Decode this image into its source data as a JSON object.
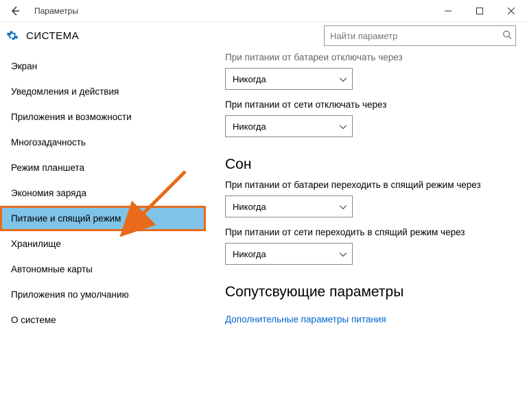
{
  "window": {
    "title": "Параметры"
  },
  "header": {
    "heading": "СИСТЕМА",
    "search_placeholder": "Найти параметр"
  },
  "sidebar": {
    "items": [
      {
        "label": "Экран",
        "selected": false
      },
      {
        "label": "Уведомления и действия",
        "selected": false
      },
      {
        "label": "Приложения и возможности",
        "selected": false
      },
      {
        "label": "Многозадачность",
        "selected": false
      },
      {
        "label": "Режим планшета",
        "selected": false
      },
      {
        "label": "Экономия заряда",
        "selected": false
      },
      {
        "label": "Питание и спящий режим",
        "selected": true
      },
      {
        "label": "Хранилище",
        "selected": false
      },
      {
        "label": "Автономные карты",
        "selected": false
      },
      {
        "label": "Приложения по умолчанию",
        "selected": false
      },
      {
        "label": "О системе",
        "selected": false
      }
    ]
  },
  "content": {
    "screen_off": {
      "battery_label": "При питании от батареи отключать через",
      "battery_value": "Никогда",
      "ac_label": "При питании от сети отключать через",
      "ac_value": "Никогда"
    },
    "sleep": {
      "heading": "Сон",
      "battery_label": "При питании от батареи переходить в спящий режим через",
      "battery_value": "Никогда",
      "ac_label": "При питании от сети переходить в спящий режим через",
      "ac_value": "Никогда"
    },
    "related": {
      "heading": "Сопутсвующие параметры",
      "link": "Дополнительные параметры питания"
    }
  },
  "annotation": {
    "arrow_color": "#e86a1a"
  }
}
